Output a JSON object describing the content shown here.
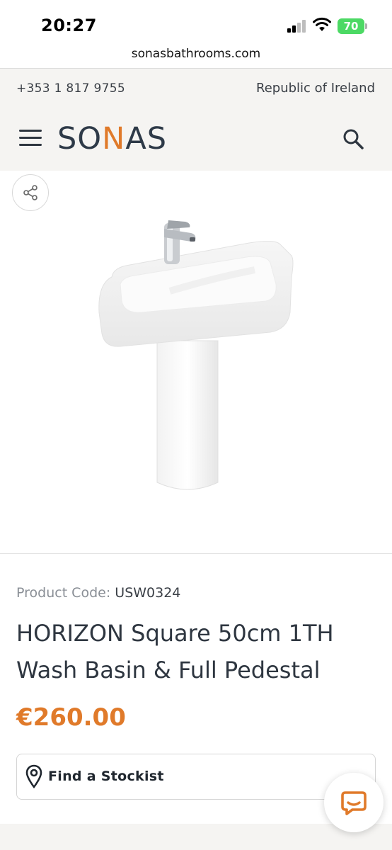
{
  "status_bar": {
    "time": "20:27",
    "battery": "70"
  },
  "browser": {
    "url": "sonasbathrooms.com"
  },
  "topstrip": {
    "phone": "+353 1 817 9755",
    "region": "Republic of Ireland"
  },
  "header": {
    "logo_prefix": "SO",
    "logo_accent": "N",
    "logo_suffix": "AS"
  },
  "product": {
    "code_label": "Product Code:",
    "code": "USW0324",
    "title": "HORIZON Square 50cm 1TH Wash Basin & Full Pedestal",
    "price": "€260.00",
    "stockist_label": "Find a Stockist"
  },
  "icons": [
    "menu-icon",
    "search-icon",
    "share-icon",
    "location-pin-icon",
    "chat-icon"
  ],
  "colors": {
    "accent": "#e07a2a",
    "text_dark": "#2e3640",
    "strip_bg": "#f5f4f2"
  }
}
